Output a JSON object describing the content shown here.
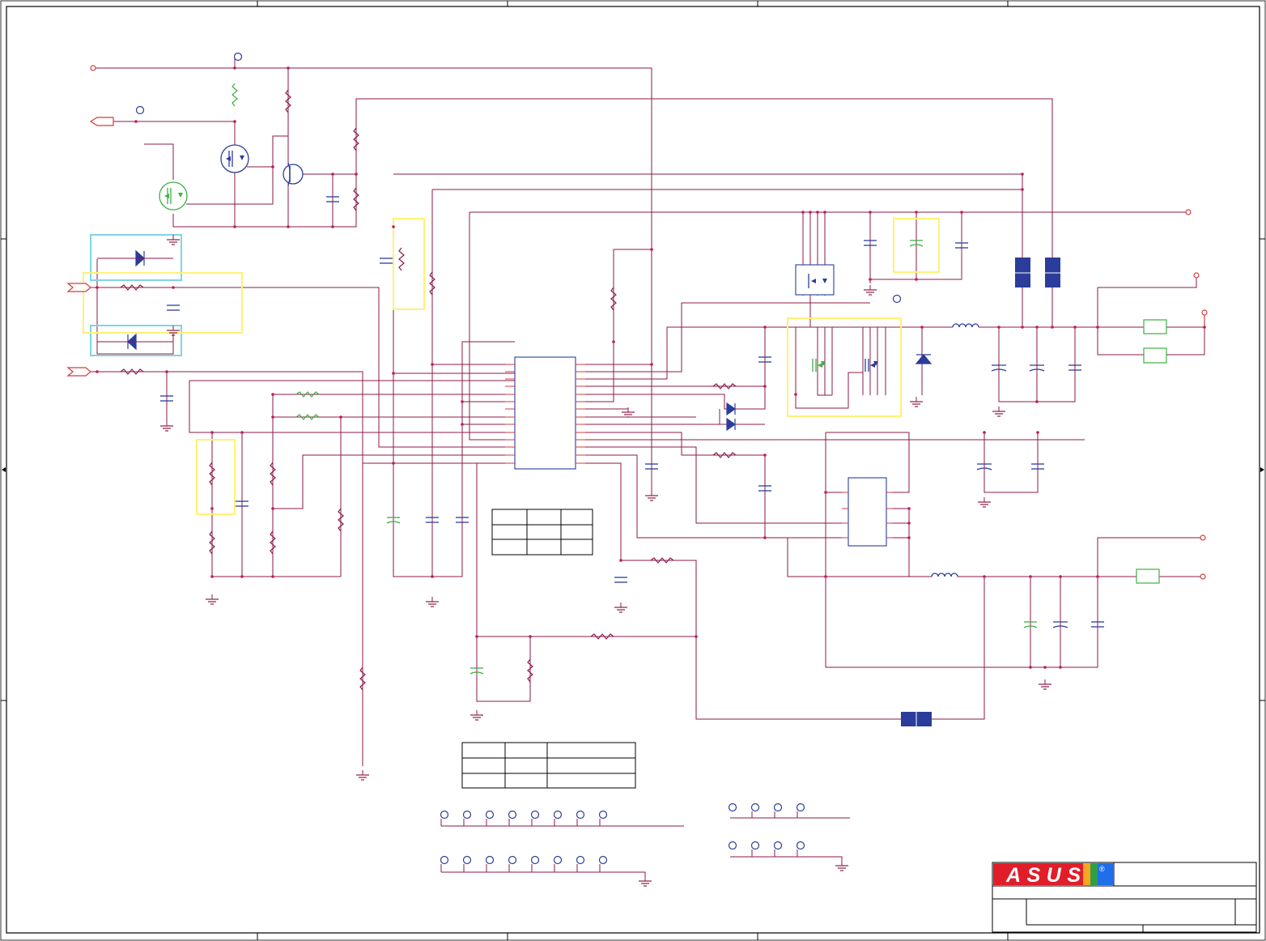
{
  "title_block": {
    "logo_text": "ASUS",
    "registered_mark": "®"
  },
  "colors": {
    "wire": "#8b1a4a",
    "frame": "#000000",
    "component": "#2b3d9a",
    "component_alt": "#3cb043",
    "pin": "#d23c3c",
    "highlight_yellow": "#fff176",
    "highlight_cyan": "#7fd4e6",
    "ground": "#8b1a4a",
    "ferrite": "#2b3d9a",
    "logo_red": "#e11d2a",
    "logo_rainbow": [
      "#e11d2a",
      "#f5a623",
      "#2ea043",
      "#1f6feb"
    ]
  },
  "icons": {
    "mosfet": "mosfet-icon",
    "transistor": "npn-transistor-icon",
    "diode": "diode-icon",
    "resistor": "resistor-icon",
    "capacitor": "capacitor-icon",
    "inductor": "inductor-icon",
    "ground": "ground-icon",
    "test_point": "test-point-icon",
    "offpage_connector": "offpage-connector-icon"
  }
}
